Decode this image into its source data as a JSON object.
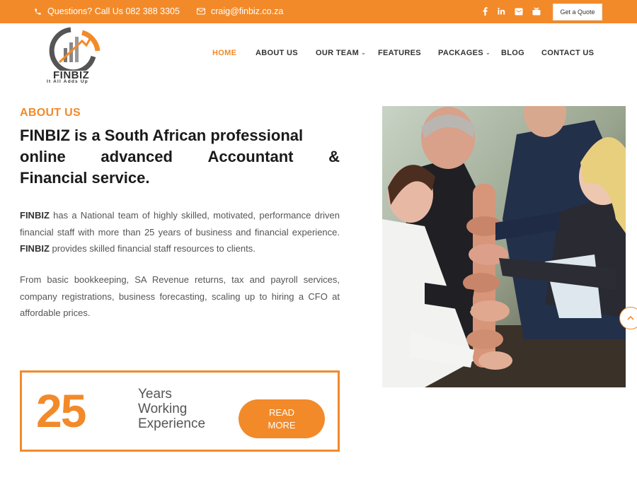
{
  "topbar": {
    "phone_text": "Questions? Call Us 082 388 3305",
    "email_text": "craig@finbiz.co.za",
    "quote_button": "Get a Quote",
    "socials": [
      "facebook-icon",
      "linkedin-icon",
      "email-icon",
      "youtube-icon"
    ]
  },
  "brand": {
    "name": "FINBIZ",
    "tagline": "It All Adds Up"
  },
  "nav": {
    "items": [
      "HOME",
      "ABOUT US",
      "OUR TEAM",
      "FEATURES",
      "PACKAGES",
      "BLOG",
      "CONTACT US"
    ],
    "active": "HOME"
  },
  "about": {
    "label": "ABOUT US",
    "headline_1": "FINBIZ is a South African professional",
    "headline_2a": "online",
    "headline_2b": "advanced",
    "headline_2c": "Accountant",
    "headline_2d": "&",
    "headline_3": "Financial service.",
    "p1_brand": "FINBIZ",
    "p1_text": " has a National team of highly skilled, motivated, performance driven financial staff with more than 25 years of business and financial experience. ",
    "p1_brand2": "FINBIZ",
    "p1_text2": " provides skilled financial staff resources to clients.",
    "p2": "From basic bookkeeping, SA Revenue returns, tax and payroll services, company registrations, business forecasting, scaling up to hiring a CFO at affordable prices."
  },
  "experience": {
    "number": "25",
    "line1": "Years",
    "line2": "Working",
    "line3": "Experience",
    "button_line1": "READ",
    "button_line2": "MORE"
  },
  "colors": {
    "accent": "#f28a2a",
    "heading": "#1a1a1a",
    "body": "#555555"
  }
}
